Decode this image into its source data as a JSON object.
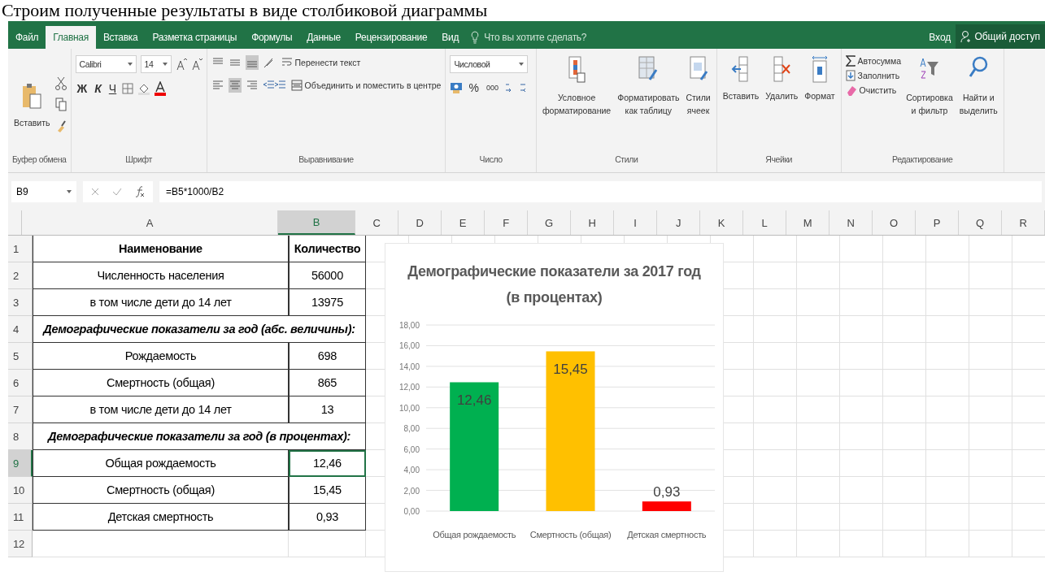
{
  "caption": "Строим полученные результаты в виде столбиковой диаграммы",
  "tabs": [
    {
      "label": "Файл",
      "selected": false
    },
    {
      "label": "Главная",
      "selected": true
    },
    {
      "label": "Вставка",
      "selected": false
    },
    {
      "label": "Разметка страницы",
      "selected": false
    },
    {
      "label": "Формулы",
      "selected": false
    },
    {
      "label": "Данные",
      "selected": false
    },
    {
      "label": "Рецензирование",
      "selected": false
    },
    {
      "label": "Вид",
      "selected": false
    }
  ],
  "tell_me": {
    "placeholder": "Что вы хотите сделать?"
  },
  "sign_in": "Вход",
  "share": "Общий доступ",
  "ribbon": {
    "paste": "Вставить",
    "clipboard_group": "Буфер обмена",
    "font_name": "Calibri",
    "font_size": "14",
    "font_group": "Шрифт",
    "bold": "Ж",
    "italic": "К",
    "underline": "Ч",
    "wrap_text": "Перенести текст",
    "merge_center": "Объединить и поместить в центре",
    "alignment_group": "Выравнивание",
    "number_format": "Числовой",
    "percent": "%",
    "thousands": "000",
    "number_group": "Число",
    "conditional": "Условное\nформатирование",
    "format_table": "Форматировать\nкак таблицу",
    "cell_styles": "Стили\nячеек",
    "styles_group": "Стили",
    "insert": "Вставить",
    "delete": "Удалить",
    "format": "Формат",
    "cells_group": "Ячейки",
    "autosum": "Автосумма",
    "fill": "Заполнить",
    "clear": "Очистить",
    "sort": "Сортировка\nи фильтр",
    "find": "Найти и\nвыделить",
    "editing_group": "Редактирование"
  },
  "formula_bar": {
    "name_box": "B9",
    "formula": "=B5*1000/B2"
  },
  "columns": [
    {
      "label": "A",
      "selected": false
    },
    {
      "label": "B",
      "selected": true
    },
    {
      "label": "C",
      "selected": false
    },
    {
      "label": "D",
      "selected": false
    },
    {
      "label": "E",
      "selected": false
    },
    {
      "label": "F",
      "selected": false
    },
    {
      "label": "G",
      "selected": false
    },
    {
      "label": "H",
      "selected": false
    },
    {
      "label": "I",
      "selected": false
    },
    {
      "label": "J",
      "selected": false
    },
    {
      "label": "K",
      "selected": false
    },
    {
      "label": "L",
      "selected": false
    },
    {
      "label": "M",
      "selected": false
    },
    {
      "label": "N",
      "selected": false
    },
    {
      "label": "O",
      "selected": false
    },
    {
      "label": "P",
      "selected": false
    },
    {
      "label": "Q",
      "selected": false
    },
    {
      "label": "R",
      "selected": false
    }
  ],
  "rows": [
    {
      "number": "1",
      "selected": false,
      "kind": "header",
      "cells": [
        "Наименование",
        "Количество"
      ]
    },
    {
      "number": "2",
      "selected": false,
      "kind": "data",
      "cells": [
        "Численность населения",
        "56000"
      ]
    },
    {
      "number": "3",
      "selected": false,
      "kind": "data",
      "cells": [
        "в том числе дети до 14 лет",
        "13975"
      ]
    },
    {
      "number": "4",
      "selected": false,
      "kind": "section",
      "cells": [
        "Демографические показатели за год (абс. величины):"
      ]
    },
    {
      "number": "5",
      "selected": false,
      "kind": "data",
      "cells": [
        "Рождаемость",
        "698"
      ]
    },
    {
      "number": "6",
      "selected": false,
      "kind": "data",
      "cells": [
        "Смертность (общая)",
        "865"
      ]
    },
    {
      "number": "7",
      "selected": false,
      "kind": "data",
      "cells": [
        "в том числе дети до 14 лет",
        "13"
      ]
    },
    {
      "number": "8",
      "selected": false,
      "kind": "section",
      "cells": [
        "Демографические показатели за год (в процентах):"
      ]
    },
    {
      "number": "9",
      "selected": true,
      "kind": "data",
      "cells": [
        "Общая рождаемость",
        "12,46"
      ]
    },
    {
      "number": "10",
      "selected": false,
      "kind": "data",
      "cells": [
        "Смертность (общая)",
        "15,45"
      ]
    },
    {
      "number": "11",
      "selected": false,
      "kind": "data",
      "cells": [
        "Детская смертность",
        "0,93"
      ]
    },
    {
      "number": "12",
      "selected": false,
      "kind": "empty",
      "cells": []
    }
  ],
  "chart": {
    "chart_data": {
      "type": "bar",
      "title": "Демографические показатели за 2017 год (в процентах)",
      "categories": [
        "Общая рождаемость",
        "Смертность (общая)",
        "Детская смертность"
      ],
      "values": [
        12.46,
        15.45,
        0.93
      ],
      "colors": [
        "#00b050",
        "#ffc000",
        "#ff0000"
      ],
      "ylim": [
        0,
        18
      ],
      "grid": true,
      "yticks": [
        {
          "value": 0,
          "label": "0,00"
        },
        {
          "value": 2,
          "label": "2,00"
        },
        {
          "value": 4,
          "label": "4,00"
        },
        {
          "value": 6,
          "label": "6,00"
        },
        {
          "value": 8,
          "label": "8,00"
        },
        {
          "value": 10,
          "label": "10,00"
        },
        {
          "value": 12,
          "label": "12,00"
        },
        {
          "value": 14,
          "label": "14,00"
        },
        {
          "value": 16,
          "label": "16,00"
        },
        {
          "value": 18,
          "label": "18,00"
        }
      ],
      "value_labels": [
        "12,46",
        "15,45",
        "0,93"
      ]
    }
  }
}
